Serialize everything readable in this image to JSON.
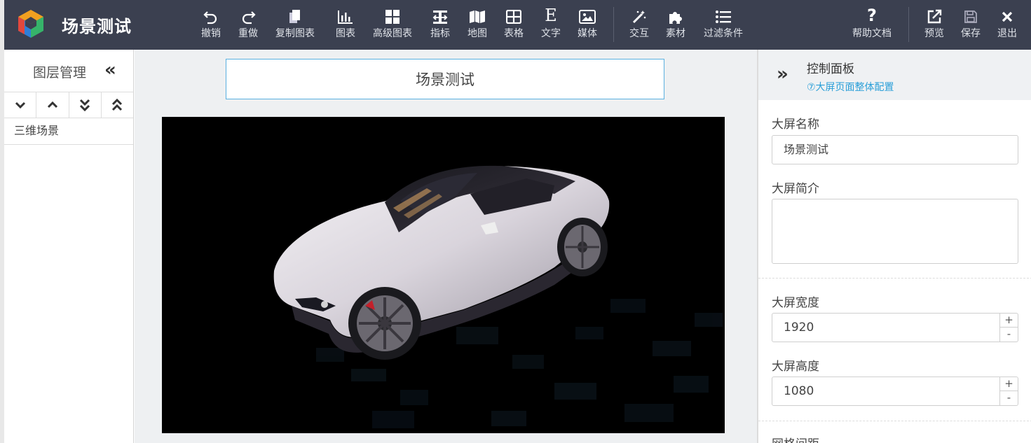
{
  "app": {
    "title": "场景测试"
  },
  "toolbar": {
    "undo": "撤销",
    "redo": "重做",
    "copy_chart": "复制图表",
    "chart": "图表",
    "advanced_chart": "高级图表",
    "indicator": "指标",
    "map": "地图",
    "table": "表格",
    "text": "文字",
    "media": "媒体",
    "interaction": "交互",
    "material": "素材",
    "filter": "过滤条件",
    "help": "帮助文档",
    "preview": "预览",
    "save": "保存",
    "exit": "退出"
  },
  "layers": {
    "title": "图层管理",
    "items": [
      "三维场景"
    ]
  },
  "canvas": {
    "screen_title": "场景测试"
  },
  "control_panel": {
    "title": "控制面板",
    "help_link": "⑦大屏页面整体配置",
    "name_label": "大屏名称",
    "name_value": "场景测试",
    "intro_label": "大屏简介",
    "width_label": "大屏宽度",
    "width_value": "1920",
    "height_label": "大屏高度",
    "height_value": "1080",
    "grid_label": "网格间距"
  },
  "colors": {
    "topbar_bg": "#3b4050",
    "accent": "#2a9fd8",
    "canvas_bg": "#eef0f2"
  }
}
